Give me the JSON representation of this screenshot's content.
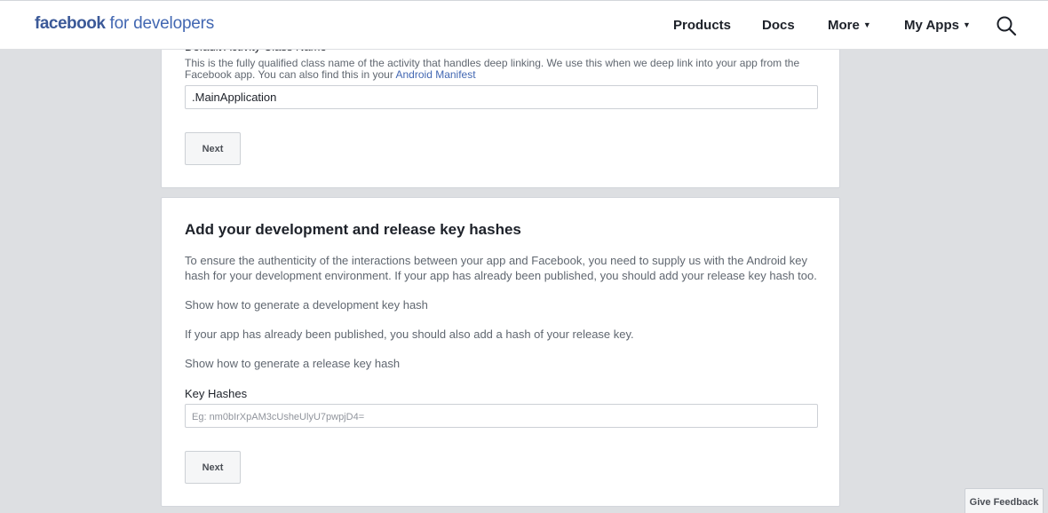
{
  "header": {
    "logo_brand": "facebook",
    "logo_suffix": " for developers",
    "nav": [
      {
        "label": "Products"
      },
      {
        "label": "Docs"
      },
      {
        "label": "More",
        "caret": "▼"
      },
      {
        "label": "My Apps",
        "caret": "▼"
      }
    ],
    "search_icon": "search-icon"
  },
  "card1": {
    "field_title": "Default Activity Class Name",
    "description": "This is the fully qualified class name of the activity that handles deep linking. We use this when we deep link into your app from the Facebook app. You can also find this in your ",
    "description_link": "Android Manifest",
    "input_value": ".MainApplication",
    "next_label": "Next"
  },
  "card2": {
    "title": "Add your development and release key hashes",
    "paragraph": "To ensure the authenticity of the interactions between your app and Facebook, you need to supply us with the Android key hash for your development environment. If your app has already been published, you should add your release key hash too.",
    "dev_link": "Show how to generate a development key hash",
    "release_note": "If your app has already been published, you should also add a hash of your release key.",
    "release_link": "Show how to generate a release key hash",
    "key_hashes_label": "Key Hashes",
    "key_hashes_placeholder": "Eg: nm0bIrXpAM3cUsheUlyU7pwpjD4=",
    "key_hashes_value": "",
    "next_label": "Next"
  },
  "feedback": {
    "label": "Give Feedback"
  },
  "colors": {
    "brand": "#4267b2",
    "background": "#dddfe2",
    "text": "#1d2129",
    "muted": "#606770"
  }
}
